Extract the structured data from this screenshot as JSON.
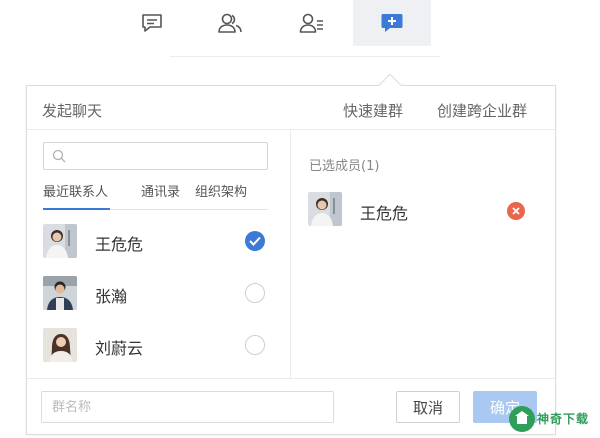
{
  "panel": {
    "title": "发起聊天",
    "quick_group": "快速建群",
    "cross_org_group": "创建跨企业群"
  },
  "search": {
    "placeholder": "",
    "value": ""
  },
  "tabs": [
    {
      "label": "最近联系人",
      "active": true
    },
    {
      "label": "通讯录",
      "active": false
    },
    {
      "label": "组织架构",
      "active": false
    }
  ],
  "contacts": [
    {
      "name": "王危危",
      "selected": true
    },
    {
      "name": "张瀚",
      "selected": false
    },
    {
      "name": "刘蔚云",
      "selected": false
    }
  ],
  "selected_panel": {
    "title": "已选成员(1)",
    "members": [
      {
        "name": "王危危"
      }
    ]
  },
  "footer": {
    "group_name_placeholder": "群名称",
    "cancel_label": "取消",
    "ok_label": "确定"
  },
  "watermark": {
    "text": "神奇下载"
  },
  "colors": {
    "accent": "#3d7ad6",
    "remove": "#e8674c",
    "ok_button": "#a9c8f2",
    "watermark": "#2f9e5a"
  },
  "icons": {
    "nav": [
      "chat-icon",
      "contacts-icon",
      "contact-list-icon",
      "add-chat-icon"
    ]
  }
}
